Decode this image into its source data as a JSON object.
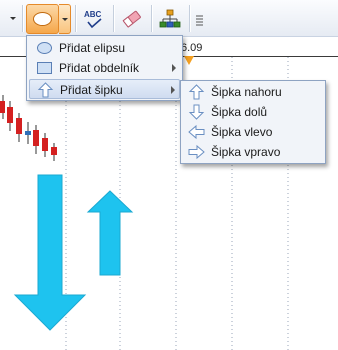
{
  "toolbar": {
    "buttons": [
      {
        "name": "partial-left-button",
        "icon": "dropdown-arrow-icon"
      },
      {
        "name": "ellipse-tool-button",
        "icon": "ellipse-icon",
        "active": true
      },
      {
        "name": "text-tool-button",
        "icon": "spellcheck-icon",
        "label": "ABC"
      },
      {
        "name": "eraser-button",
        "icon": "eraser-icon"
      },
      {
        "name": "hierarchy-button",
        "icon": "hierarchy-icon"
      },
      {
        "name": "overflow-button",
        "icon": "menu-lines-icon"
      }
    ]
  },
  "ruler": {
    "date_fragment": "6.09"
  },
  "shape_menu": {
    "items": [
      {
        "label": "Přidat elipsu",
        "icon": "ellipse-icon",
        "has_submenu": false
      },
      {
        "label": "Přidat obdelník",
        "icon": "rectangle-icon",
        "has_submenu": true
      },
      {
        "label": "Přidat šipku",
        "icon": "arrow-up-icon",
        "has_submenu": true,
        "highlighted": true
      }
    ]
  },
  "arrow_submenu": {
    "items": [
      {
        "label": "Šipka nahoru",
        "icon": "arrow-up-icon"
      },
      {
        "label": "Šipka dolů",
        "icon": "arrow-down-icon"
      },
      {
        "label": "Šipka vlevo",
        "icon": "arrow-left-icon"
      },
      {
        "label": "Šipka vpravo",
        "icon": "arrow-right-icon"
      }
    ]
  },
  "colors": {
    "accent_orange": "#f5a74a",
    "arrow_cyan": "#1ec3ef",
    "candle_red": "#d42020",
    "candle_blue": "#2f6fb8"
  }
}
